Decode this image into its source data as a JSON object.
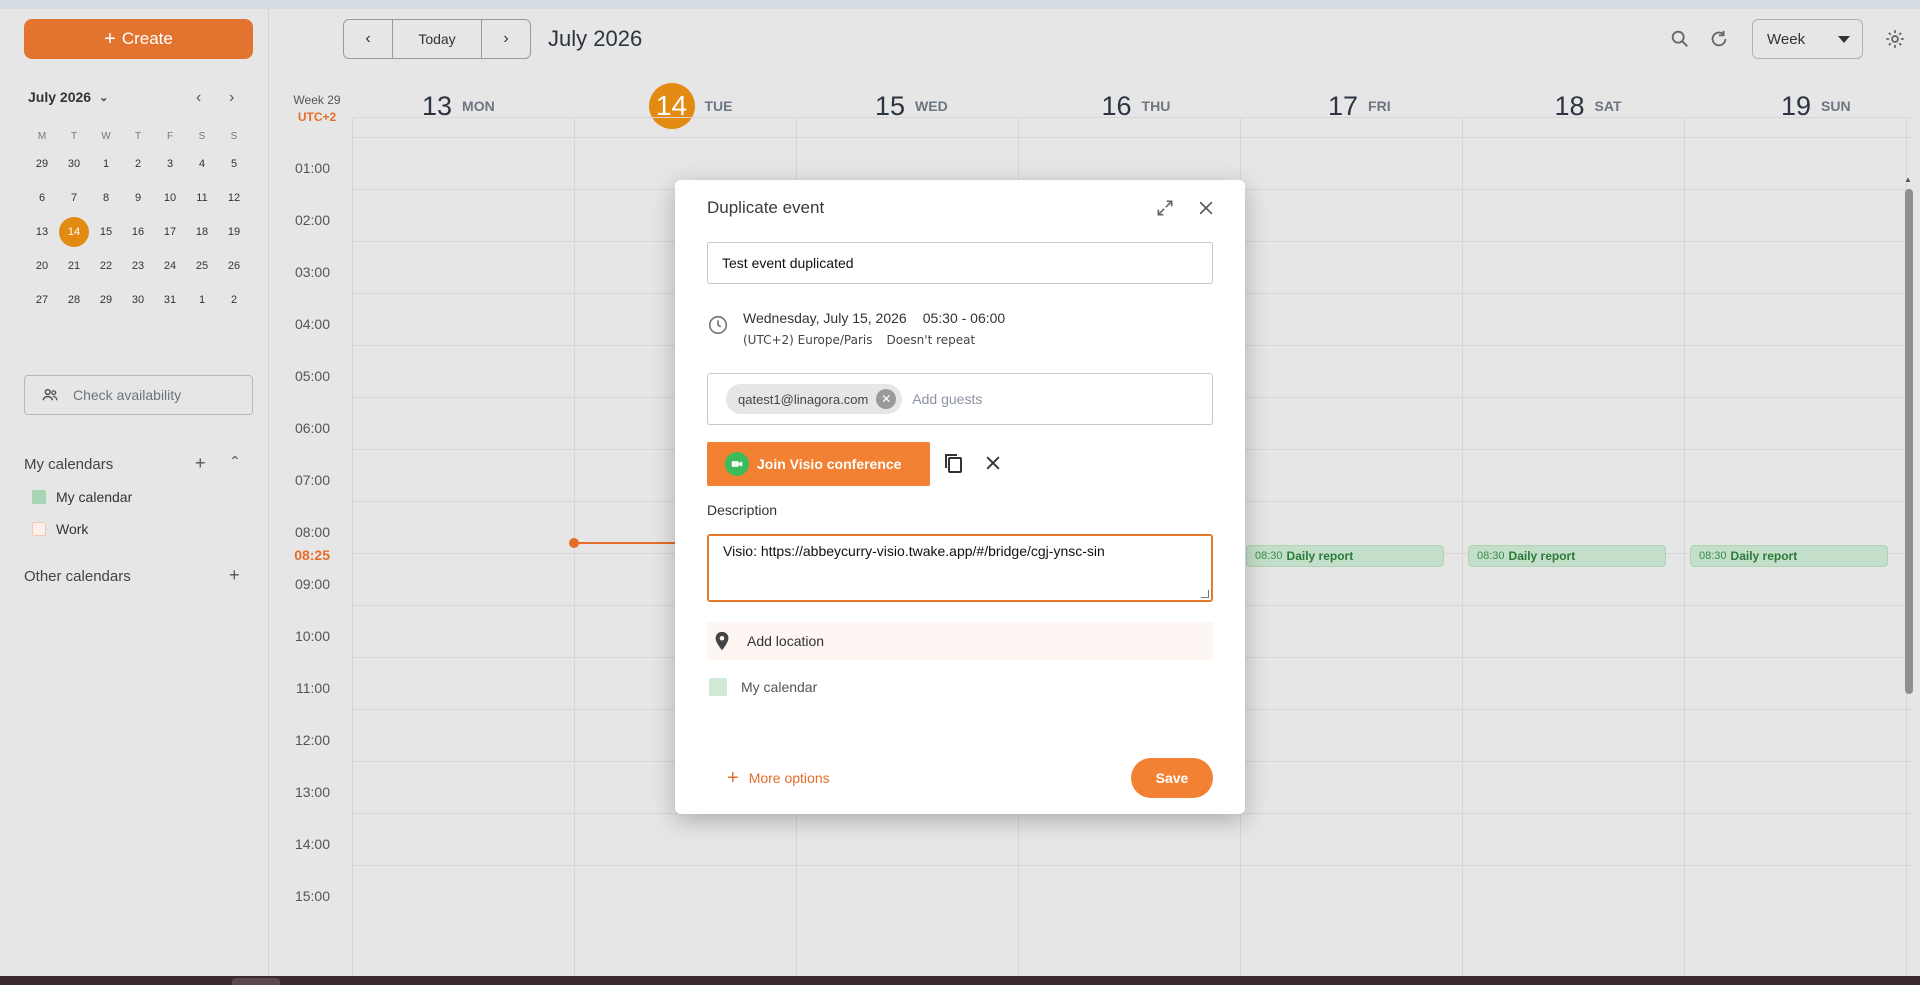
{
  "toolbar": {
    "create_label": "Create",
    "today_label": "Today",
    "month_title": "July 2026",
    "view": "Week"
  },
  "mini_calendar": {
    "title": "July 2026",
    "weekday_headers": [
      "M",
      "T",
      "W",
      "T",
      "F",
      "S",
      "S"
    ],
    "weeks": [
      [
        "29",
        "30",
        "1",
        "2",
        "3",
        "4",
        "5"
      ],
      [
        "6",
        "7",
        "8",
        "9",
        "10",
        "11",
        "12"
      ],
      [
        "13",
        "14",
        "15",
        "16",
        "17",
        "18",
        "19"
      ],
      [
        "20",
        "21",
        "22",
        "23",
        "24",
        "25",
        "26"
      ],
      [
        "27",
        "28",
        "29",
        "30",
        "31",
        "1",
        "2"
      ]
    ],
    "selected_day": "14"
  },
  "sidebar": {
    "check_availability": "Check availability",
    "my_calendars_title": "My calendars",
    "calendars": [
      {
        "label": "My calendar",
        "color": "#a8d5b3",
        "checked": true
      },
      {
        "label": "Work",
        "color": "#f5d6c4",
        "checked": false
      }
    ],
    "other_calendars_title": "Other calendars"
  },
  "week": {
    "label": "Week 29",
    "timezone": "UTC+2",
    "days": [
      {
        "num": "13",
        "name": "MON",
        "today": false
      },
      {
        "num": "14",
        "name": "TUE",
        "today": true
      },
      {
        "num": "15",
        "name": "WED",
        "today": false
      },
      {
        "num": "16",
        "name": "THU",
        "today": false
      },
      {
        "num": "17",
        "name": "FRI",
        "today": false
      },
      {
        "num": "18",
        "name": "SAT",
        "today": false
      },
      {
        "num": "19",
        "name": "SUN",
        "today": false
      }
    ],
    "hours": [
      "01:00",
      "02:00",
      "03:00",
      "04:00",
      "05:00",
      "06:00",
      "07:00",
      "08:00",
      "09:00",
      "10:00",
      "11:00",
      "12:00",
      "13:00",
      "14:00",
      "15:00"
    ],
    "now_time": "08:25",
    "events": [
      {
        "day": "FRI",
        "time": "08:30",
        "title": "Daily report"
      },
      {
        "day": "SAT",
        "time": "08:30",
        "title": "Daily report"
      },
      {
        "day": "SUN",
        "time": "08:30",
        "title": "Daily report"
      }
    ]
  },
  "dialog": {
    "title": "Duplicate event",
    "event_title": "Test event duplicated",
    "date": "Wednesday, July 15, 2026",
    "time_range": "05:30 - 06:00",
    "timezone": "(UTC+2) Europe/Paris",
    "repeat": "Doesn't repeat",
    "guest": "qatest1@linagora.com",
    "guests_placeholder": "Add guests",
    "visio_label": "Join Visio conference",
    "description_label": "Description",
    "description": "Visio: https://abbeycurry-visio.twake.app/#/bridge/cgj-ynsc-sin",
    "location_placeholder": "Add location",
    "calendar": "My calendar",
    "more_options": "More options",
    "save_label": "Save"
  },
  "colors": {
    "accent": "#e56d2b",
    "today": "#e38a12",
    "event_bg": "#c4dfc9"
  }
}
